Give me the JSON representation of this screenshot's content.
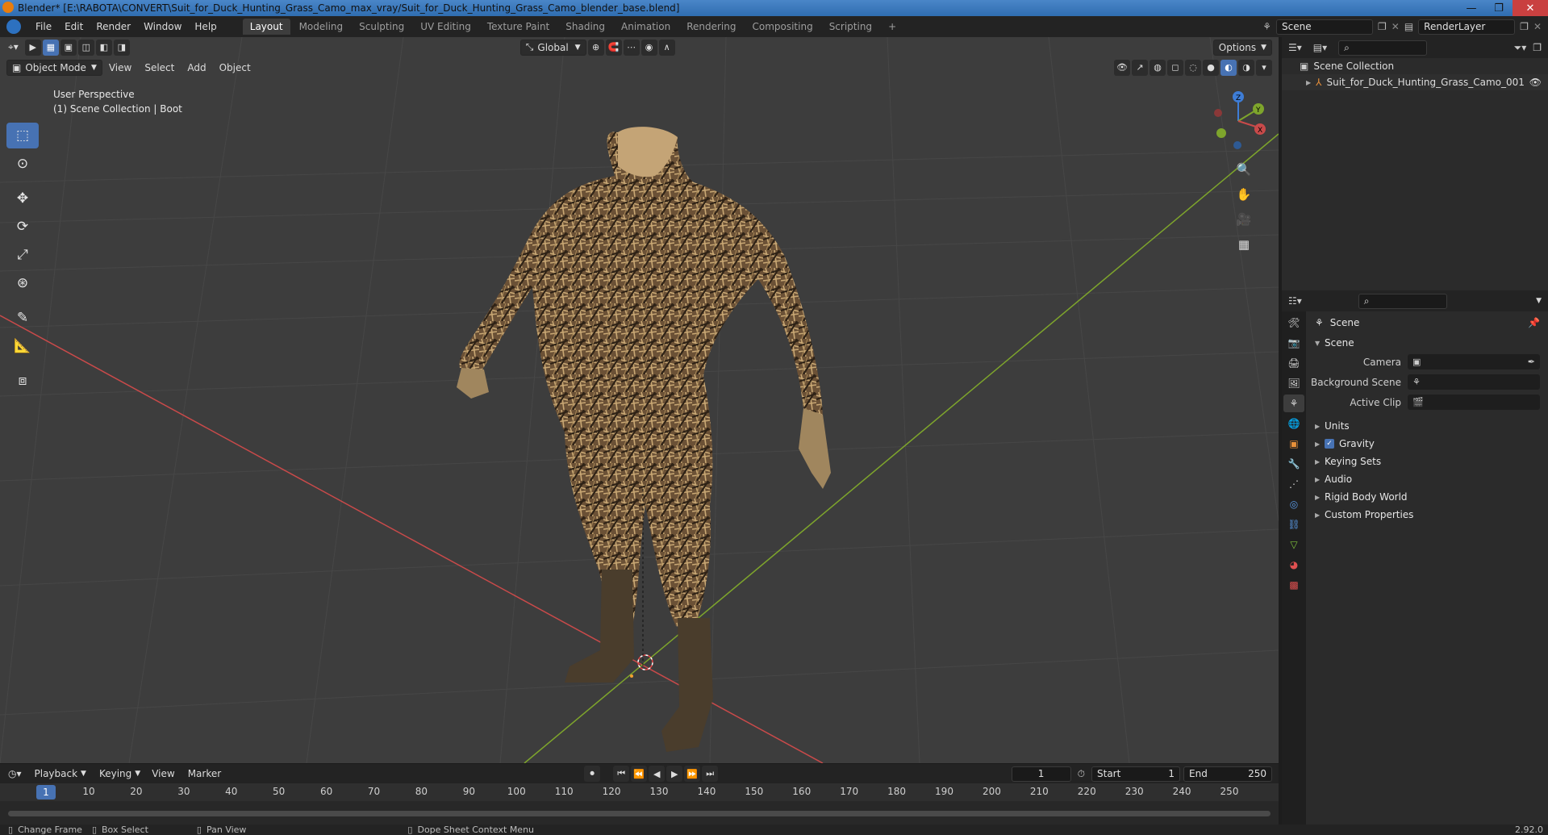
{
  "window": {
    "title": "Blender* [E:\\RABOTA\\CONVERT\\Suit_for_Duck_Hunting_Grass_Camo_max_vray/Suit_for_Duck_Hunting_Grass_Camo_blender_base.blend]",
    "minimize": "—",
    "maximize": "❐",
    "close": "✕"
  },
  "menu": {
    "items": [
      "File",
      "Edit",
      "Render",
      "Window",
      "Help"
    ]
  },
  "workspaces": {
    "tabs": [
      "Layout",
      "Modeling",
      "Sculpting",
      "UV Editing",
      "Texture Paint",
      "Shading",
      "Animation",
      "Rendering",
      "Compositing",
      "Scripting"
    ],
    "add": "+",
    "active": "Layout"
  },
  "topright": {
    "scene": "Scene",
    "render_layer": "RenderLayer"
  },
  "viewport": {
    "transform_orientation": "Global",
    "options": "Options",
    "mode": "Object Mode",
    "menus": [
      "View",
      "Select",
      "Add",
      "Object"
    ],
    "info_line1": "User Perspective",
    "info_line2": "(1) Scene Collection | Boot",
    "gizmo_labels": {
      "x": "X",
      "y": "Y",
      "z": "Z"
    }
  },
  "timeline": {
    "menus": [
      "Playback",
      "Keying",
      "View",
      "Marker"
    ],
    "current_frame": "1",
    "start_label": "Start",
    "start": "1",
    "end_label": "End",
    "end": "250",
    "ticks": [
      "1",
      "10",
      "20",
      "30",
      "40",
      "50",
      "60",
      "70",
      "80",
      "90",
      "100",
      "110",
      "120",
      "130",
      "140",
      "150",
      "160",
      "170",
      "180",
      "190",
      "200",
      "210",
      "220",
      "230",
      "240",
      "250"
    ]
  },
  "statusbar": {
    "items": [
      "Change Frame",
      "Box Select",
      "Pan View",
      "Dope Sheet Context Menu"
    ],
    "version": "2.92.0"
  },
  "outliner": {
    "root": "Scene Collection",
    "object": "Suit_for_Duck_Hunting_Grass_Camo_001"
  },
  "properties": {
    "title": "Scene",
    "section": "Scene",
    "rows": [
      {
        "label": "Camera",
        "value": ""
      },
      {
        "label": "Background Scene",
        "value": ""
      },
      {
        "label": "Active Clip",
        "value": ""
      }
    ],
    "panels": [
      "Units",
      "Gravity",
      "Keying Sets",
      "Audio",
      "Rigid Body World",
      "Custom Properties"
    ]
  },
  "colors": {
    "accent": "#4772b3",
    "viewport_bg": "#3d3d3d",
    "x_axis": "#c94a4a",
    "y_axis": "#7ea52c",
    "z_axis": "#3e7dd6"
  }
}
